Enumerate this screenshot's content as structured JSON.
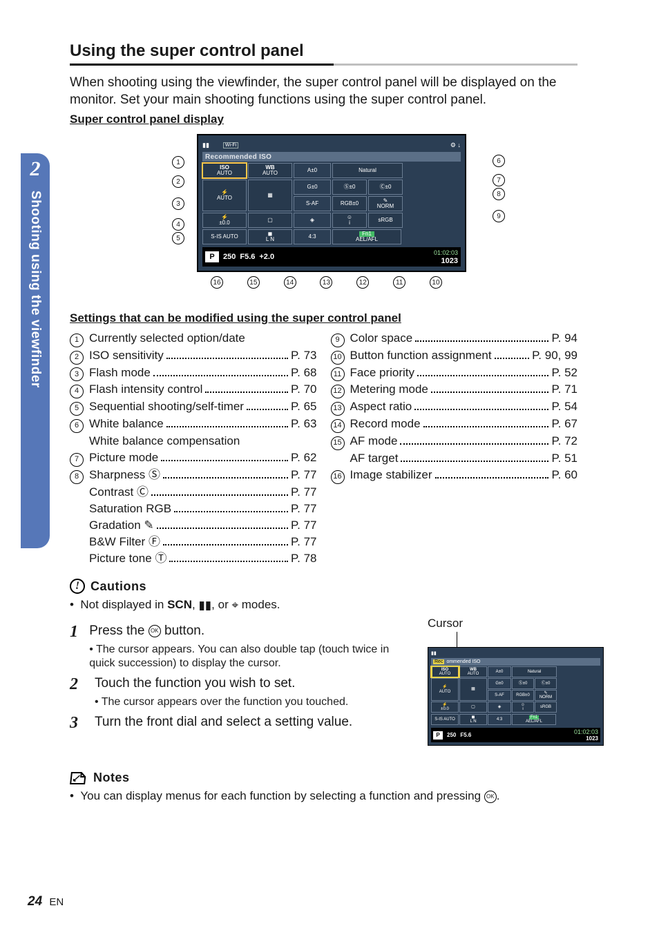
{
  "header": {
    "title": "Using the super control panel",
    "intro": "When shooting using the viewfinder, the super control panel will be displayed on the monitor. Set your main shooting functions using the super control panel.",
    "subhead": "Super control panel display"
  },
  "tab": {
    "number": "2",
    "label": "Shooting using the viewfinder"
  },
  "scp": {
    "recommended": "Recommended ISO",
    "iso_label": "ISO",
    "iso_value": "AUTO",
    "wb_label": "WB",
    "wb_value": "AUTO",
    "a_pm": "A±0",
    "g_pm": "G±0",
    "picmode": "Natural",
    "s_pm": "Ⓢ±0",
    "c_pm": "Ⓒ±0",
    "flash_label": "AUTO",
    "saf": "S-AF",
    "rgb_pm": "RGB±0",
    "grad": "NORM",
    "face": "i",
    "srgb": "sRGB",
    "flash_comp": "±0.0",
    "fn1": "Fn1",
    "sis": "S-IS AUTO",
    "ln": "L N",
    "aspect": "4:3",
    "ael": "AEL/AFL",
    "mode": "P",
    "shutter": "250",
    "ap": "F5.6",
    "ev": "+2.0",
    "time": "01:02:03",
    "shots": "1023"
  },
  "settings_title": "Settings that can be modified using the super control panel",
  "settings_left": [
    {
      "n": "1",
      "label": "Currently selected option/date",
      "page": ""
    },
    {
      "n": "2",
      "label": "ISO sensitivity",
      "page": "P. 73"
    },
    {
      "n": "3",
      "label": "Flash mode",
      "page": "P. 68"
    },
    {
      "n": "4",
      "label": "Flash intensity control",
      "page": "P. 70"
    },
    {
      "n": "5",
      "label": "Sequential shooting/self-timer",
      "page": "P. 65"
    },
    {
      "n": "6",
      "label": "White balance",
      "page": "P. 63"
    },
    {
      "n": "",
      "label": "White balance compensation",
      "page": ""
    },
    {
      "n": "7",
      "label": "Picture mode",
      "page": "P. 62"
    },
    {
      "n": "8",
      "label": "Sharpness Ⓢ",
      "page": "P. 77"
    },
    {
      "n": "",
      "label": "Contrast Ⓒ",
      "page": "P. 77"
    },
    {
      "n": "",
      "label": "Saturation RGB",
      "page": "P. 77"
    },
    {
      "n": "",
      "label": "Gradation ✎",
      "page": "P. 77"
    },
    {
      "n": "",
      "label": "B&W Filter Ⓕ",
      "page": "P. 77"
    },
    {
      "n": "",
      "label": "Picture tone Ⓣ",
      "page": "P. 78"
    }
  ],
  "settings_right": [
    {
      "n": "9",
      "label": "Color space",
      "page": "P. 94"
    },
    {
      "n": "10",
      "label": "Button function assignment",
      "page": "P. 90, 99"
    },
    {
      "n": "11",
      "label": "Face priority",
      "page": "P. 52"
    },
    {
      "n": "12",
      "label": "Metering mode",
      "page": "P. 71"
    },
    {
      "n": "13",
      "label": "Aspect ratio",
      "page": "P. 54"
    },
    {
      "n": "14",
      "label": "Record mode",
      "page": "P. 67"
    },
    {
      "n": "15",
      "label": "AF mode",
      "page": "P. 72"
    },
    {
      "n": "",
      "label": "AF target",
      "page": "P. 51"
    },
    {
      "n": "16",
      "label": "Image stabilizer",
      "page": "P. 60"
    }
  ],
  "cautions": {
    "title": "Cautions",
    "line": "Not displayed in SCN, ▮▮, or ⌖ modes."
  },
  "steps": [
    {
      "n": "1",
      "body": "Press the ⊛ button.",
      "sub": "The cursor appears. You can also double tap (touch twice in quick succession) to display the cursor."
    },
    {
      "n": "2",
      "body": "Touch the function you wish to set.",
      "sub": "The cursor appears over the function you touched."
    },
    {
      "n": "3",
      "body": "Turn the front dial and select a setting value.",
      "sub": ""
    }
  ],
  "cursor_label": "Cursor",
  "notes": {
    "title": "Notes",
    "line": "You can display menus for each function by selecting a function and pressing ⊛."
  },
  "footer": {
    "page": "24",
    "lang": "EN"
  },
  "callouts_left": [
    "1",
    "2",
    "3",
    "4",
    "5"
  ],
  "callouts_right": [
    "6",
    "7",
    "8",
    "9"
  ],
  "callouts_bottom": [
    "16",
    "15",
    "14",
    "13",
    "12",
    "11",
    "10"
  ]
}
